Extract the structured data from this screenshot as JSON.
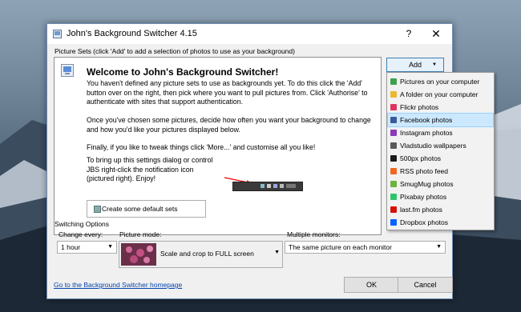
{
  "window": {
    "title": "John's Background Switcher 4.15",
    "help": "?",
    "close": "✕"
  },
  "picture_sets": {
    "label": "Picture Sets (click 'Add' to add a selection of photos to use as your background)",
    "welcome_title": "Welcome to John's Background Switcher!",
    "para1": "You haven't defined any picture sets to use as backgrounds yet. To do this click the 'Add' button over on the right, then pick where you want to pull pictures from. Click 'Authorise' to authenticate with sites that support authentication.",
    "para2": "Once you've chosen some pictures, decide how often you want your background to change and how you'd like your pictures displayed below.",
    "para3": "Finally, if you like to tweak things click 'More...' and customise all you like!",
    "para4": "To bring up this settings dialog or control JBS right-click the notification icon (pictured right). Enjoy!",
    "default_button": "Create some default sets"
  },
  "add_button": "Add",
  "add_menu": [
    {
      "label": "Pictures on your computer",
      "color": "#3aa34a"
    },
    {
      "label": "A folder on your computer",
      "color": "#e8b931"
    },
    {
      "label": "Flickr photos",
      "color": "#e0335f"
    },
    {
      "label": "Facebook photos",
      "color": "#3b5998",
      "selected": true
    },
    {
      "label": "Instagram photos",
      "color": "#8a3ab9"
    },
    {
      "label": "Vladstudio wallpapers",
      "color": "#5a5a5a"
    },
    {
      "label": "500px photos",
      "color": "#1a1a1a"
    },
    {
      "label": "RSS photo feed",
      "color": "#f26522"
    },
    {
      "label": "SmugMug photos",
      "color": "#6db33f"
    },
    {
      "label": "Pixabay photos",
      "color": "#2ec66b"
    },
    {
      "label": "last.fm photos",
      "color": "#d51007"
    },
    {
      "label": "Dropbox photos",
      "color": "#0061fe"
    }
  ],
  "switching": {
    "label": "Switching Options",
    "change_every_label": "Change every:",
    "change_every_value": "1 hour",
    "picture_mode_label": "Picture mode:",
    "picture_mode_value": "Scale and crop to FULL screen",
    "multi_label": "Multiple monitors:",
    "multi_value": "The same picture on each monitor"
  },
  "footer": {
    "homepage_link": "Go to the Background Switcher homepage",
    "ok": "OK",
    "cancel": "Cancel"
  }
}
